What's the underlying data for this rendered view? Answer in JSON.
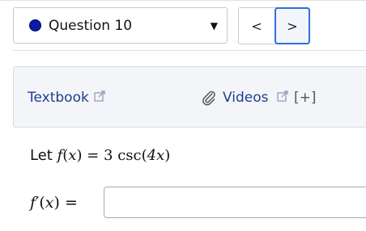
{
  "question_selector": {
    "label": "Question 10",
    "status_color": "#0b1aa8",
    "caret": "▼"
  },
  "navigation": {
    "prev_symbol": "<",
    "next_symbol": ">"
  },
  "resources": {
    "textbook_label": "Textbook",
    "videos_label": "Videos",
    "expand_label": "[+]",
    "icons": [
      "external-link-icon",
      "paperclip-icon",
      "external-link-icon"
    ]
  },
  "problem": {
    "prefix": "Let",
    "function_name": "f",
    "variable": "x",
    "equals": "=",
    "coefficient": "3",
    "trig_function": "csc",
    "argument": "4x"
  },
  "answer": {
    "label_function": "f",
    "label_prime": "′",
    "variable": "x",
    "equals": "=",
    "value": ""
  }
}
